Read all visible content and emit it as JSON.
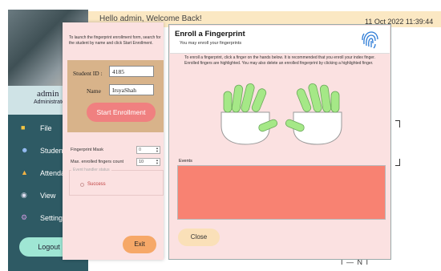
{
  "background": {
    "greeting": "Hello admin, Welcome Back!",
    "datetime": "11 Oct 2022 11:39:44",
    "user": {
      "name": "admin",
      "role": "Administrator"
    },
    "sidebar": [
      {
        "label": "File",
        "icon": "folder-icon"
      },
      {
        "label": "Students",
        "icon": "students-icon"
      },
      {
        "label": "Attendance",
        "icon": "attendance-icon"
      },
      {
        "label": "View",
        "icon": "view-icon"
      },
      {
        "label": "Settings",
        "icon": "settings-icon"
      }
    ],
    "logout_label": "Logout",
    "bottom_text": "I — N I"
  },
  "form": {
    "instruction": "To launch the fingerprint enrollment form, search for the student by name and click Start Enrollment.",
    "student_id_label": "Student ID :",
    "student_id_value": "4185",
    "name_label": "Name",
    "name_value": "IrsyaShah",
    "start_button": "Start Enrollment",
    "fingerprint_mask_label": "Fingerprint Mask",
    "fingerprint_mask_value": "0",
    "max_count_label": "Max. enrolled fingers count",
    "max_count_value": "10",
    "event_status_label": "Event handler status",
    "event_status_value": "Success",
    "exit_button": "Exit"
  },
  "dialog": {
    "title": "Enroll a Fingerprint",
    "subtitle": "You may enroll your fingerprints",
    "description": "To enroll a fingerprint, click a finger on the hands below. It is recommended that you enroll your index finger. Enrolled fingers are highlighted. You may also delete an enrolled fingerprint by clicking a highlighted finger.",
    "events_label": "Events",
    "close_button": "Close"
  },
  "colors": {
    "sidebar": "#2e5a64",
    "form_bg": "#fbe1e1",
    "student_box": "#d8b38a",
    "start_button": "#f08080",
    "exit_button": "#f6a868",
    "events_box": "#f88272",
    "close_button": "#fae0b8",
    "enrolled_finger": "#a5e887"
  }
}
